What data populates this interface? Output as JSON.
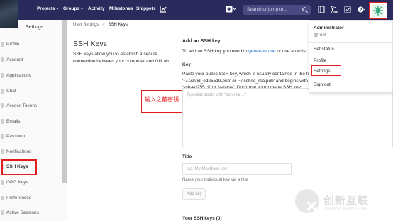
{
  "colors": {
    "navbar": "#2b2a5c",
    "link": "#1f78d1",
    "annotation": "#e02020",
    "sidebar_bg": "#fafafa"
  },
  "nav": {
    "projects": "Projects",
    "groups": "Groups",
    "activity": "Activity",
    "milestones": "Milestones",
    "snippets": "Snippets",
    "search_placeholder": "Search or jump to...",
    "icons": [
      "chart-icon",
      "plus-icon",
      "search-icon",
      "layout-icon",
      "merge-request-icon",
      "todo-icon",
      "help-icon",
      "avatar-icon"
    ]
  },
  "sidebar": {
    "header": "Settings",
    "items": [
      {
        "label": "Profile",
        "icon": "profile-icon"
      },
      {
        "label": "Account",
        "icon": "account-icon"
      },
      {
        "label": "Applications",
        "icon": "applications-icon"
      },
      {
        "label": "Chat",
        "icon": "chat-icon"
      },
      {
        "label": "Access Tokens",
        "icon": "token-icon"
      },
      {
        "label": "Emails",
        "icon": "email-icon"
      },
      {
        "label": "Password",
        "icon": "lock-icon"
      },
      {
        "label": "Notifications",
        "icon": "bell-icon"
      },
      {
        "label": "SSH Keys",
        "icon": "key-icon",
        "active": true
      },
      {
        "label": "GPG Keys",
        "icon": "key-icon"
      },
      {
        "label": "Preferences",
        "icon": "preferences-icon"
      },
      {
        "label": "Active Sessions",
        "icon": "sessions-icon"
      }
    ]
  },
  "breadcrumb": {
    "parent": "User Settings",
    "separator": ">",
    "current": "SSH Keys"
  },
  "page": {
    "title": "SSH Keys",
    "description": "SSH keys allow you to establish a secure connection between your computer and GitLab."
  },
  "annotation": {
    "text": "输入之前密钥"
  },
  "form": {
    "section_title": "Add an SSH key",
    "add_prefix": "To add an SSH key you need to ",
    "add_link": "generate one",
    "add_suffix": " or use an exist",
    "key_label": "Key",
    "key_help": "Paste your public SSH key, which is usually contained in the file '~/.ssh/id_ed25519.pub' or '~/.ssh/id_rsa.pub' and begins with 'ssh-ed25519' or 'ssh-rsa'. Don't use your private SSH key.",
    "key_placeholder": "Typically starts with \"ssh-rsa ...\"",
    "title_label": "Title",
    "title_placeholder": "e.g. My MacBook key",
    "title_help": "Name your individual key via a title",
    "add_button": "Add key",
    "your_keys": "Your SSH keys (0)"
  },
  "dropdown": {
    "name": "Administrator",
    "username": "@root",
    "set_status": "Set status",
    "profile": "Profile",
    "settings": "Settings",
    "sign_out": "Sign out"
  },
  "watermark": {
    "chinese": "创新互联",
    "english": "CHUANG XIN HU LIAN"
  }
}
